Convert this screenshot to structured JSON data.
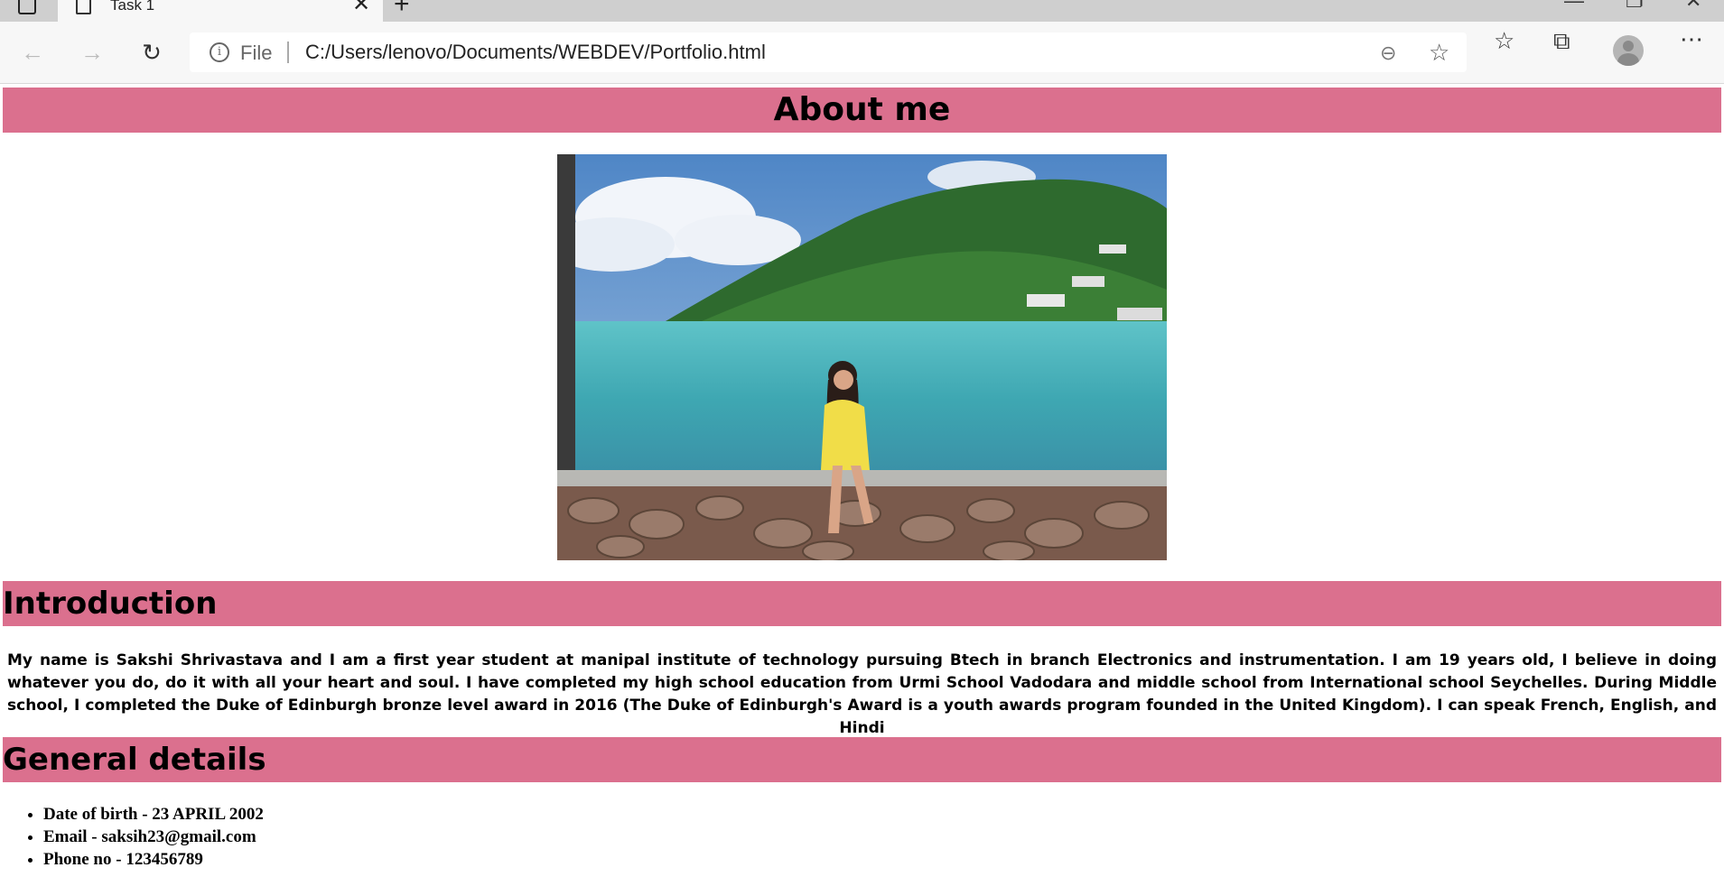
{
  "browser": {
    "tab_title": "Task 1",
    "new_tab_label": "+",
    "address_prefix": "File",
    "url": "C:/Users/lenovo/Documents/WEBDEV/Portfolio.html",
    "icons": [
      "back-icon",
      "forward-icon",
      "refresh-icon",
      "info-icon",
      "zoom-out-icon",
      "add-favorite-icon",
      "favorites-icon",
      "collections-icon",
      "profile-icon",
      "more-icon"
    ]
  },
  "page": {
    "about_heading": "About me",
    "intro_heading": "Introduction",
    "intro_text": "My name is Sakshi Shrivastava and I am a first year student at manipal institute of technology pursuing Btech in branch Electronics and instrumentation. I am 19 years old, I believe in doing whatever you do, do it with all your heart and soul. I have completed my high school education from Urmi School Vadodara and middle school from International school Seychelles. During Middle school, I completed the Duke of Edinburgh bronze level award in 2016 (The Duke of Edinburgh's Award is a youth awards program founded in the United Kingdom). I can speak French, English, and Hindi",
    "general_heading": "General details",
    "details": [
      "Date of birth - 23 APRIL 2002",
      "Email - saksih23@gmail.com",
      "Phone no - 123456789"
    ],
    "header_color": "#db708e"
  }
}
